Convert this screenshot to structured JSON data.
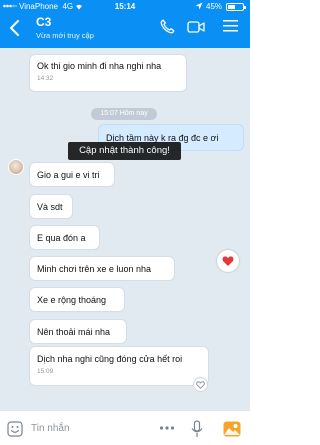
{
  "status_bar": {
    "carrier": "VinaPhone",
    "network": "4G",
    "time": "15:14",
    "battery_percent": "45%",
    "battery_level": 0.45
  },
  "header": {
    "contact_name": "C3",
    "presence": "Vừa mới truy cập"
  },
  "messages": [
    {
      "text": "Ok thi gio minh đi nha nghi nha",
      "time": "14:32"
    },
    {
      "text": "Dịch tầm này k ra đg đc e ơi"
    },
    {
      "text": "Gio a gui e vi tri"
    },
    {
      "text": "Và sdt"
    },
    {
      "text": "E qua đón a"
    },
    {
      "text": "Minh chơi trên xe e luon nha"
    },
    {
      "text": "Xe e rộng thoáng"
    },
    {
      "text": "Nên thoải mái nha"
    },
    {
      "text": "Dịch nha nghi cũng đóng cửa hết roi",
      "time": "15:09"
    }
  ],
  "time_separator": "15:07 Hôm nay",
  "toast": "Cập nhật thành công!",
  "input": {
    "placeholder": "Tin nhắn"
  },
  "colors": {
    "header": "#0a90f5",
    "chat_bg": "#e1e9f1",
    "own_bubble": "#d5ebff",
    "heart": "#e5383b"
  },
  "icons": [
    "back-arrow-icon",
    "phone-icon",
    "video-icon",
    "menu-icon",
    "heart-icon",
    "like-heart-icon",
    "sticker-icon",
    "more-icon",
    "mic-icon",
    "image-icon"
  ]
}
